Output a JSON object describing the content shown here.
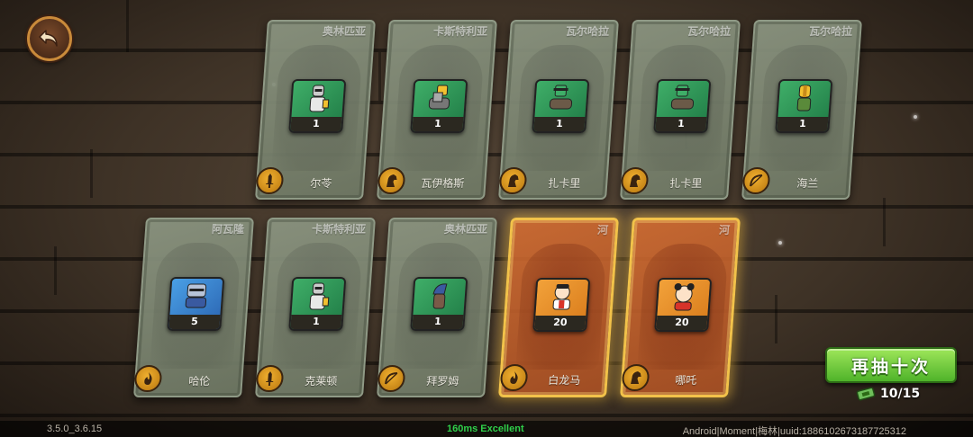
{
  "back_button": {
    "icon": "back-arrow-icon"
  },
  "cards_row1": [
    {
      "faction": "奥林匹亚",
      "name": "尔苓",
      "count": "1",
      "piece_color": "green",
      "class_icon": "sword-icon",
      "rarity": "normal"
    },
    {
      "faction": "卡斯特利亚",
      "name": "瓦伊格斯",
      "count": "1",
      "piece_color": "green",
      "class_icon": "horse-icon",
      "rarity": "normal"
    },
    {
      "faction": "瓦尔哈拉",
      "name": "扎卡里",
      "count": "1",
      "piece_color": "green",
      "class_icon": "horse-icon",
      "rarity": "normal"
    },
    {
      "faction": "瓦尔哈拉",
      "name": "扎卡里",
      "count": "1",
      "piece_color": "green",
      "class_icon": "horse-icon",
      "rarity": "normal"
    },
    {
      "faction": "瓦尔哈拉",
      "name": "海兰",
      "count": "1",
      "piece_color": "green",
      "class_icon": "bow-icon",
      "rarity": "normal"
    }
  ],
  "cards_row2": [
    {
      "faction": "阿瓦隆",
      "name": "哈伦",
      "count": "5",
      "piece_color": "blue",
      "class_icon": "flame-icon",
      "rarity": "normal"
    },
    {
      "faction": "卡斯特利亚",
      "name": "克莱顿",
      "count": "1",
      "piece_color": "green",
      "class_icon": "sword-icon",
      "rarity": "normal"
    },
    {
      "faction": "奥林匹亚",
      "name": "拜罗姆",
      "count": "1",
      "piece_color": "green",
      "class_icon": "bow-icon",
      "rarity": "normal"
    },
    {
      "faction": "河",
      "name": "白龙马",
      "count": "20",
      "piece_color": "orange",
      "class_icon": "flame-icon",
      "rarity": "gold"
    },
    {
      "faction": "河",
      "name": "哪吒",
      "count": "20",
      "piece_color": "orange",
      "class_icon": "horse-icon",
      "rarity": "gold"
    }
  ],
  "redraw": {
    "label": "再抽十次",
    "tickets": "10/15",
    "ticket_icon": "ticket-icon"
  },
  "footer": {
    "version": "3.5.0_3.6.15",
    "ping": "160ms Excellent",
    "device": "Android|Moment|梅林|uuid:1886102673187725312"
  },
  "colors": {
    "gold_border": "#f2c24a",
    "button_green": "#4fb32a",
    "ping_green": "#2fd04a"
  }
}
